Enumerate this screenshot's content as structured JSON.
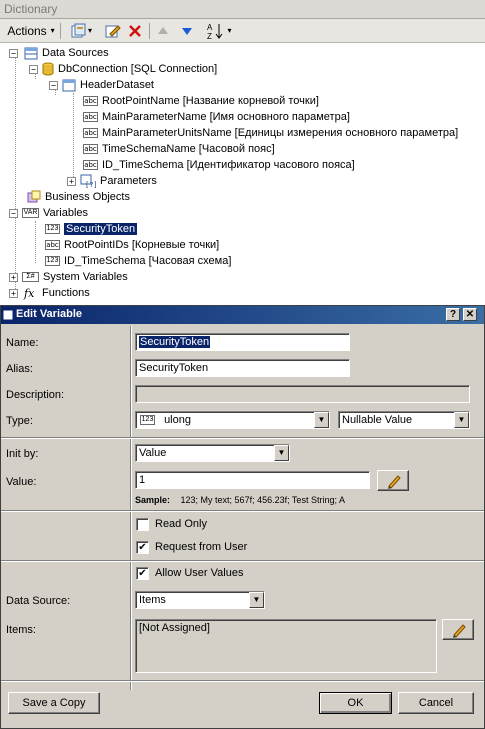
{
  "panel": {
    "title": "Dictionary"
  },
  "toolbar": {
    "actions_label": "Actions",
    "actions_arrow": "▾",
    "new_arrow": "▾",
    "sort_arrow": "▾"
  },
  "tree": {
    "data_sources": "Data Sources",
    "db_connection": "DbConnection [SQL Connection]",
    "header_dataset": "HeaderDataset",
    "columns": [
      "RootPointName [Название корневой точки]",
      "MainParameterName [Имя основного параметра]",
      "MainParameterUnitsName [Единицы измерения основного параметра]",
      "TimeSchemaName [Часовой пояс]",
      "ID_TimeSchema [Идентификатор часового пояса]"
    ],
    "parameters": "Parameters",
    "business_objects": "Business Objects",
    "variables": "Variables",
    "variable_items": [
      "SecurityToken",
      "RootPointIDs [Корневые точки]",
      "ID_TimeSchema [Часовая схема]"
    ],
    "system_variables": "System Variables",
    "functions": "Functions",
    "icon_abc": "abc",
    "icon_123": "123",
    "icon_var": "VAR",
    "icon_sys": "Σ#",
    "icon_fx": "fx",
    "expand_plus": "+",
    "expand_minus": "−"
  },
  "dialog": {
    "title": "Edit Variable",
    "help_btn": "?",
    "close_btn": "✕",
    "name_label": "Name:",
    "name_value": "SecurityToken",
    "alias_label": "Alias:",
    "alias_value": "SecurityToken",
    "description_label": "Description:",
    "description_value": "",
    "type_label": "Type:",
    "type_icon": "123",
    "type_value": "ulong",
    "nullable_value": "Nullable Value",
    "init_by_label": "Init by:",
    "init_by_value": "Value",
    "value_label": "Value:",
    "value_value": "1",
    "sample_label": "Sample:",
    "sample_value": "123; My text; 567f; 456.23f; Test String; A",
    "read_only_label": "Read Only",
    "read_only_checked": false,
    "request_label": "Request from User",
    "request_checked": true,
    "allow_label": "Allow User Values",
    "allow_checked": true,
    "data_source_label": "Data Source:",
    "data_source_value": "Items",
    "items_label": "Items:",
    "items_value": "[Not Assigned]",
    "save_copy": "Save a Copy",
    "ok": "OK",
    "cancel": "Cancel",
    "check_mark": "✔",
    "combo_arrow": "▼"
  },
  "colors": {
    "selection": "#0a246a",
    "title_gradient_start": "#0a246a",
    "title_gradient_end": "#3a6ea5"
  }
}
